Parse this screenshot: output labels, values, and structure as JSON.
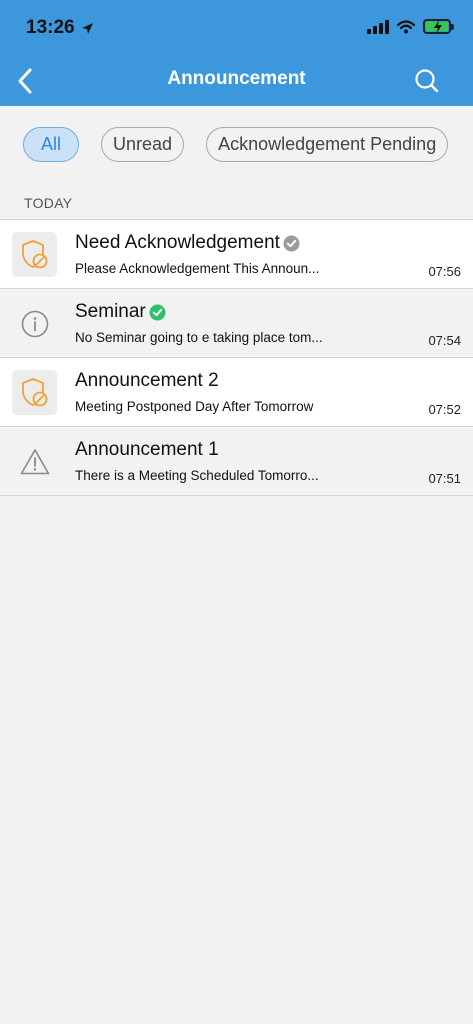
{
  "status_bar": {
    "time": "13:26"
  },
  "header": {
    "title": "Announcement"
  },
  "filters": [
    {
      "label": "All",
      "active": true
    },
    {
      "label": "Unread",
      "active": false
    },
    {
      "label": "Acknowledgement Pending",
      "active": false
    }
  ],
  "section": {
    "label": "TODAY"
  },
  "items": [
    {
      "title": "Need Acknowledgement",
      "subtitle": "Please Acknowledgement This Announ...",
      "time": "07:56",
      "icon": "shield-block-icon",
      "check": "gray-check-icon",
      "unread": true
    },
    {
      "title": "Seminar",
      "subtitle": "No Seminar going to e taking place tom...",
      "time": "07:54",
      "icon": "info-icon",
      "check": "green-check-icon",
      "unread": false
    },
    {
      "title": "Announcement 2",
      "subtitle": "Meeting Postponed Day After Tomorrow",
      "time": "07:52",
      "icon": "shield-block-icon",
      "check": "",
      "unread": true
    },
    {
      "title": "Announcement 1",
      "subtitle": "There is a Meeting Scheduled Tomorro...",
      "time": "07:51",
      "icon": "warning-icon",
      "check": "",
      "unread": false
    }
  ],
  "colors": {
    "header": "#3d97dd",
    "accent": "#2f86dc",
    "orange_icon": "#f0a136",
    "green_check": "#2fc06b",
    "gray_check": "#9a9a9a"
  }
}
